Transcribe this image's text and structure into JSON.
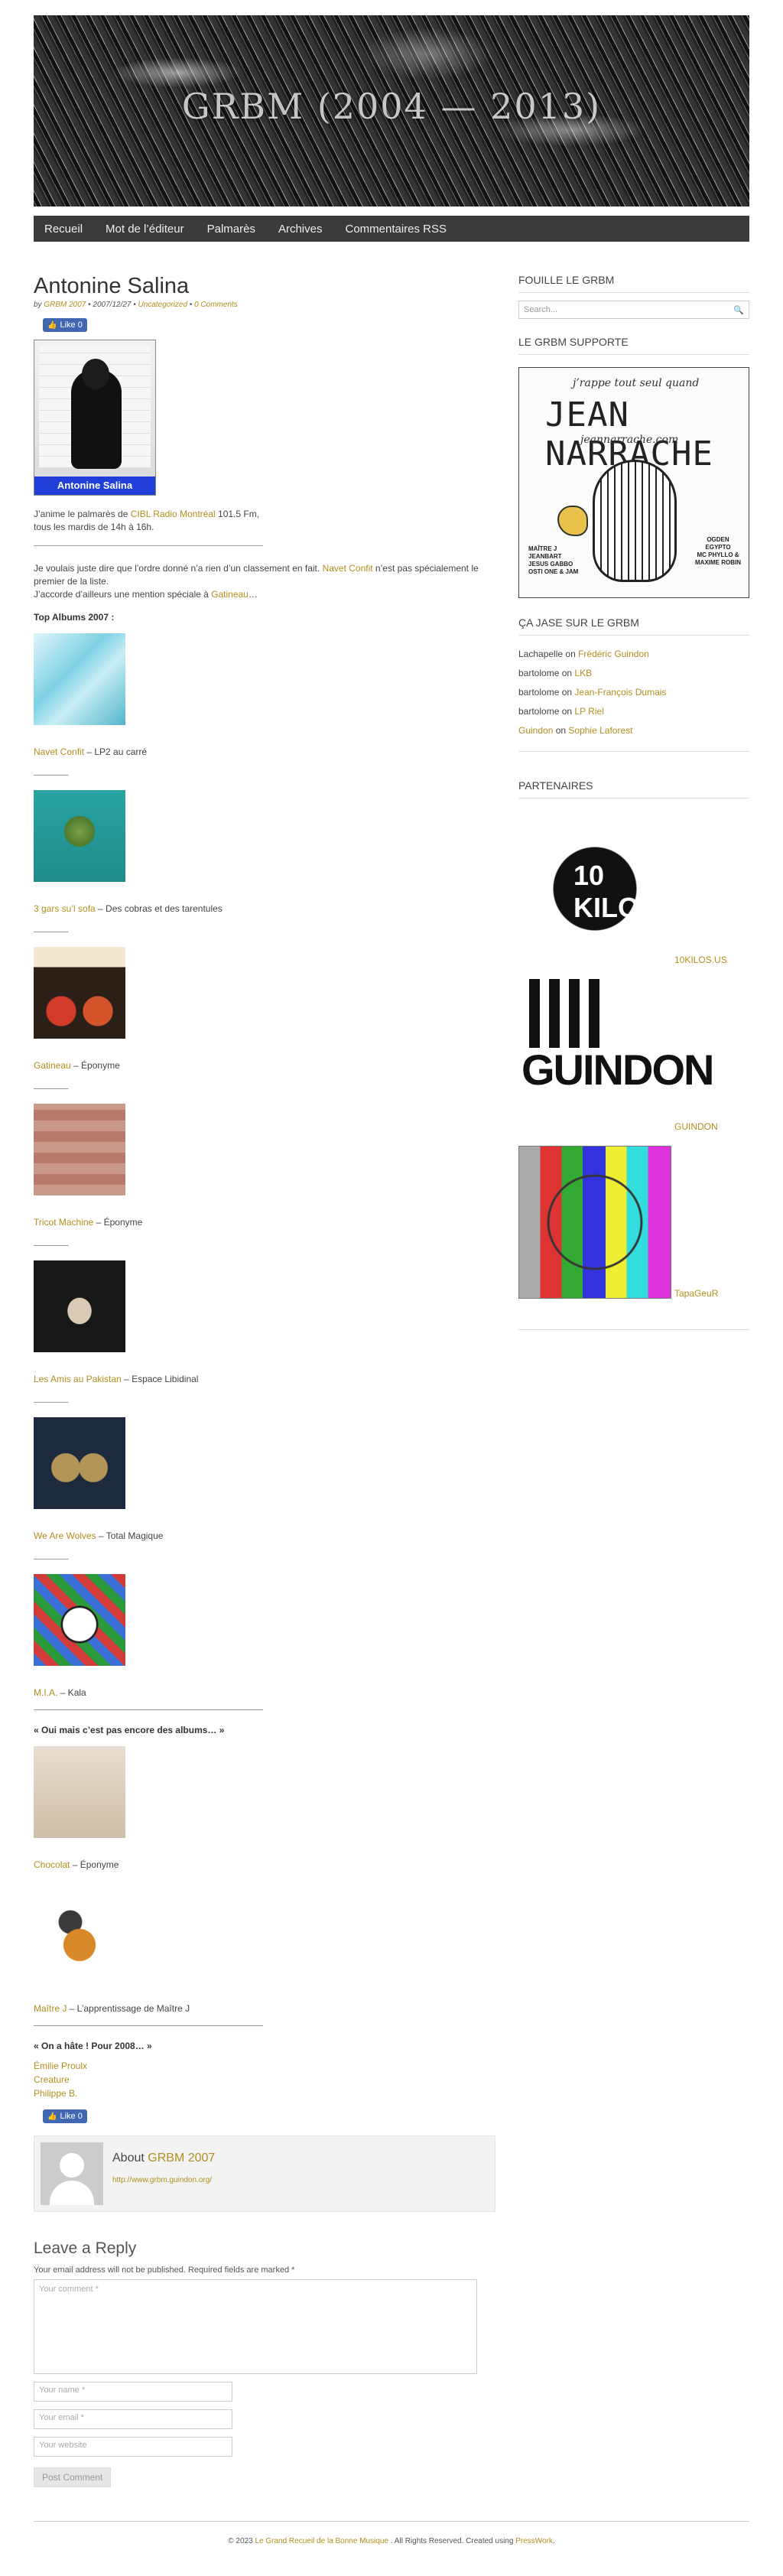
{
  "site": {
    "title": "GRBM (2004 — 2013)"
  },
  "nav": [
    "Recueil",
    "Mot de l’éditeur",
    "Palmarès",
    "Archives",
    "Commentaires RSS"
  ],
  "post": {
    "title": "Antonine Salina",
    "meta_by": "by",
    "meta_author": "GRBM 2007",
    "meta_date": " • 2007/12/27 • ",
    "meta_category": "Uncategorized",
    "meta_sep": " • ",
    "meta_comments": "0 Comments",
    "like_label": "Like 0",
    "portrait_label": "Antonine Salina",
    "intro_1": "J’anime le palmarès de ",
    "intro_link": "CIBL Radio Montréal",
    "intro_2": " 101.5 Fm,",
    "intro_3": "tous les mardis de 14h à 16h.",
    "long_rule": "——————————————————————————————",
    "p2_1": "Je voulais juste dire que l’ordre donné n’a rien d’un classement en fait. ",
    "p2_link": "Navet Confit",
    "p2_2": " n’est pas spécialement le premier de la liste.",
    "p2_3": "J’accorde d’ailleurs une mention spéciale à ",
    "p2_link2": "Gatineau",
    "p2_4": "…",
    "top_heading": "Top Albums 2007 :",
    "short_rule": "————–",
    "albums": [
      {
        "artist": "Navet Confit",
        "title": " – LP2 au carré"
      },
      {
        "artist": "3 gars su’l sofa",
        "title": " – Des cobras et des tarentules"
      },
      {
        "artist": "Gatineau",
        "title": " – Éponyme"
      },
      {
        "artist": "Tricot Machine",
        "title": " – Éponyme"
      },
      {
        "artist": "Les Amis au Pakistan",
        "title": " – Espace Libidinal"
      },
      {
        "artist": "We Are Wolves",
        "title": " – Total Magique"
      },
      {
        "artist": "M.I.A.",
        "title": " – Kala"
      }
    ],
    "not_yet_heading": "« Oui mais c’est pas encore des albums… »",
    "not_yet": [
      {
        "artist": "Chocolat",
        "title": " – Éponyme"
      },
      {
        "artist": "Maître J",
        "title": " – L’apprentissage de Maître J"
      }
    ],
    "rush_heading": "« On a hâte ! Pour 2008… »",
    "rush": [
      "Émilie Proulx",
      "Creature",
      "Philippe B."
    ],
    "author_title_pre": "About ",
    "author_name": "GRBM 2007",
    "author_url": "http://www.grbm.guindon.org/"
  },
  "reply": {
    "title": "Leave a Reply",
    "note": "Your email address will not be published. Required fields are marked *",
    "comment_placeholder": "Your comment *",
    "name_placeholder": "Your name *",
    "email_placeholder": "Your email *",
    "website_placeholder": "Your website",
    "submit": "Post Comment"
  },
  "sidebar": {
    "follow_title": "FOUILLE LE GRBM",
    "search_placeholder": "Search...",
    "supports_title": "LE GRBM SUPPORTE",
    "jn_tag": "j’rappe tout seul quand",
    "jn_big": "JEAN NARRACHE",
    "jn_url": "jeannarrache.com",
    "jn_left": [
      "MAÎTRE J",
      "JEANBART",
      "JESUS GABBO",
      "OSTI ONE & JAM"
    ],
    "jn_right": [
      "OGDEN",
      "EGYPTO",
      "MC PHYLLO &",
      "MAXIME ROBIN"
    ],
    "chat_title": "ÇA JASE SUR LE GRBM",
    "recent": [
      {
        "who": "Lachapelle",
        "on": " on ",
        "post": "Frédéric Guindon"
      },
      {
        "who": "bartolome",
        "on": " on ",
        "post": "LKB"
      },
      {
        "who": "bartolome",
        "on": " on ",
        "post": "Jean-François Dumais"
      },
      {
        "who": "bartolome",
        "on": " on ",
        "post": "LP Riel"
      },
      {
        "who": "Guindon",
        "on": " on ",
        "post": "Sophie Laforest",
        "who_link": true
      }
    ],
    "partners_title": "PARTENAIRES",
    "partners": [
      {
        "label": "10KILOS.US",
        "logo": "10 KILOS"
      },
      {
        "label": "GUINDON",
        "logo": "GUINDON"
      },
      {
        "label": "TapaGeuR",
        "logo": ""
      }
    ]
  },
  "footer": {
    "pre": "© 2023 ",
    "site": "Le Grand Recueil de la Bonne Musique",
    "mid": " . All Rights Reserved. Created using ",
    "theme": "PressWork",
    "end": "."
  }
}
